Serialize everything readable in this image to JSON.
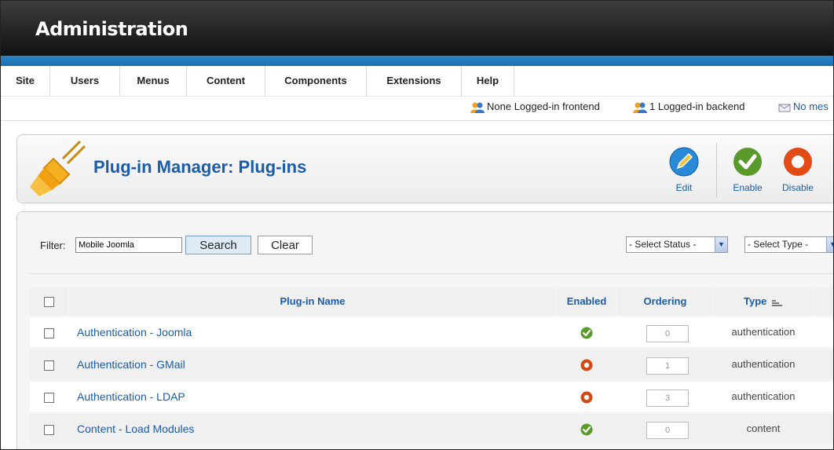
{
  "header": {
    "title": "Administration"
  },
  "menu": [
    "Site",
    "Users",
    "Menus",
    "Content",
    "Components",
    "Extensions",
    "Help"
  ],
  "status": {
    "frontend": "None Logged-in frontend",
    "backend": "1 Logged-in backend",
    "messages": "No mes"
  },
  "toolbar": {
    "title": "Plug-in Manager: Plug-ins",
    "edit_label": "Edit",
    "enable_label": "Enable",
    "disable_label": "Disable"
  },
  "filter": {
    "label": "Filter:",
    "value": "Mobile Joomla",
    "search_label": "Search",
    "clear_label": "Clear",
    "status_select": "- Select Status -",
    "type_select": "- Select Type -"
  },
  "table": {
    "headers": {
      "name": "Plug-in Name",
      "enabled": "Enabled",
      "ordering": "Ordering",
      "type": "Type"
    },
    "rows": [
      {
        "name": "Authentication - Joomla",
        "enabled": true,
        "ordering": "0",
        "type": "authentication"
      },
      {
        "name": "Authentication - GMail",
        "enabled": false,
        "ordering": "1",
        "type": "authentication"
      },
      {
        "name": "Authentication - LDAP",
        "enabled": false,
        "ordering": "3",
        "type": "authentication"
      },
      {
        "name": "Content - Load Modules",
        "enabled": true,
        "ordering": "0",
        "type": "content"
      }
    ]
  },
  "colors": {
    "link": "#1a5ca8",
    "enabled": "#5a9a2a",
    "disabled": "#d24a12",
    "accent": "#1a6eb0"
  }
}
